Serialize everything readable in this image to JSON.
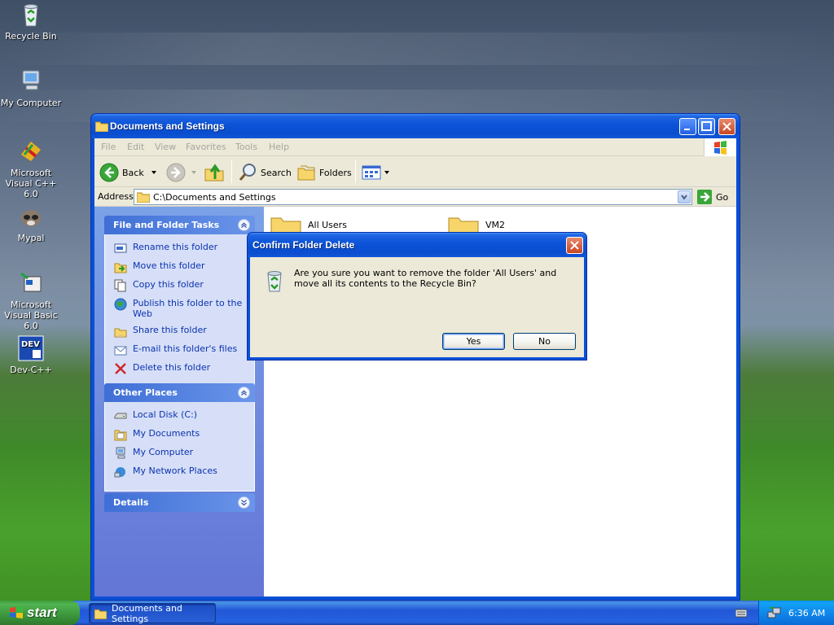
{
  "desktop": {
    "icons": [
      {
        "label": "Recycle Bin",
        "icon": "recycle-bin-icon"
      },
      {
        "label": "My Computer",
        "icon": "computer-icon"
      },
      {
        "label": "Microsoft Visual C++ 6.0",
        "icon": "visual-cpp-icon"
      },
      {
        "label": "Mypal",
        "icon": "mypal-icon"
      },
      {
        "label": "Microsoft Visual Basic 6.0",
        "icon": "visual-basic-icon"
      },
      {
        "label": "Dev-C++",
        "icon": "devcpp-icon"
      }
    ]
  },
  "window": {
    "title": "Documents and Settings",
    "menu": [
      "File",
      "Edit",
      "View",
      "Favorites",
      "Tools",
      "Help"
    ],
    "toolbar": {
      "back": "Back",
      "search": "Search",
      "folders": "Folders"
    },
    "address": {
      "label": "Address",
      "value": "C:\\Documents and Settings",
      "go": "Go"
    },
    "file_tasks": {
      "title": "File and Folder Tasks",
      "items": [
        {
          "label": "Rename this folder",
          "icon": "rename-icon"
        },
        {
          "label": "Move this folder",
          "icon": "move-icon"
        },
        {
          "label": "Copy this folder",
          "icon": "copy-icon"
        },
        {
          "label": "Publish this folder to the Web",
          "icon": "globe-icon"
        },
        {
          "label": "Share this folder",
          "icon": "share-icon"
        },
        {
          "label": "E-mail this folder's files",
          "icon": "email-icon"
        },
        {
          "label": "Delete this folder",
          "icon": "delete-icon"
        }
      ]
    },
    "other_places": {
      "title": "Other Places",
      "items": [
        {
          "label": "Local Disk (C:)",
          "icon": "disk-icon"
        },
        {
          "label": "My Documents",
          "icon": "documents-icon"
        },
        {
          "label": "My Computer",
          "icon": "computer-icon"
        },
        {
          "label": "My Network Places",
          "icon": "network-icon"
        }
      ]
    },
    "details": {
      "title": "Details"
    },
    "files": [
      {
        "name": "All Users"
      },
      {
        "name": "VM2"
      }
    ]
  },
  "dialog": {
    "title": "Confirm Folder Delete",
    "message": "Are you sure you want to remove the folder 'All Users' and move all its contents to the Recycle Bin?",
    "yes": "Yes",
    "no": "No"
  },
  "taskbar": {
    "start": "start",
    "task": "Documents and Settings",
    "clock": "6:36 AM"
  },
  "colors": {
    "xp_blue": "#0a4fd6",
    "task_link": "#0c32b0",
    "start_green": "#3c963c"
  }
}
